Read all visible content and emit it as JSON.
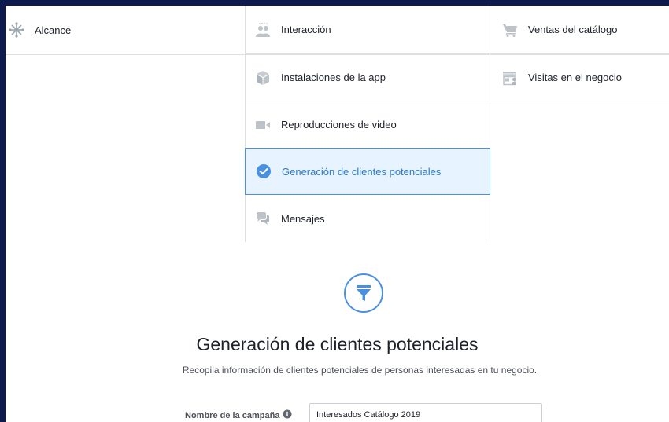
{
  "objectives": {
    "left": [
      {
        "label": "Alcance",
        "icon": "reach-icon"
      }
    ],
    "middle": [
      {
        "label": "Interacción",
        "icon": "engagement-icon"
      },
      {
        "label": "Instalaciones de la app",
        "icon": "app-installs-icon"
      },
      {
        "label": "Reproducciones de video",
        "icon": "video-camera-icon"
      },
      {
        "label": "Generación de clientes potenciales",
        "icon": "checkmark-icon",
        "selected": true
      },
      {
        "label": "Mensajes",
        "icon": "messages-icon"
      }
    ],
    "right": [
      {
        "label": "Ventas del catálogo",
        "icon": "cart-icon"
      },
      {
        "label": "Visitas en el negocio",
        "icon": "store-icon"
      }
    ]
  },
  "hero": {
    "icon": "funnel-icon",
    "title": "Generación de clientes potenciales",
    "description": "Recopila información de clientes potenciales de personas interesadas en tu negocio."
  },
  "campaign_name": {
    "label": "Nombre de la campaña",
    "value": "Interesados Catálogo 2019"
  },
  "colors": {
    "accent": "#4a90e2",
    "selected_bg": "#e7f3ff",
    "icon_gray": "#bec3c9",
    "frame": "#0c1a4d"
  }
}
